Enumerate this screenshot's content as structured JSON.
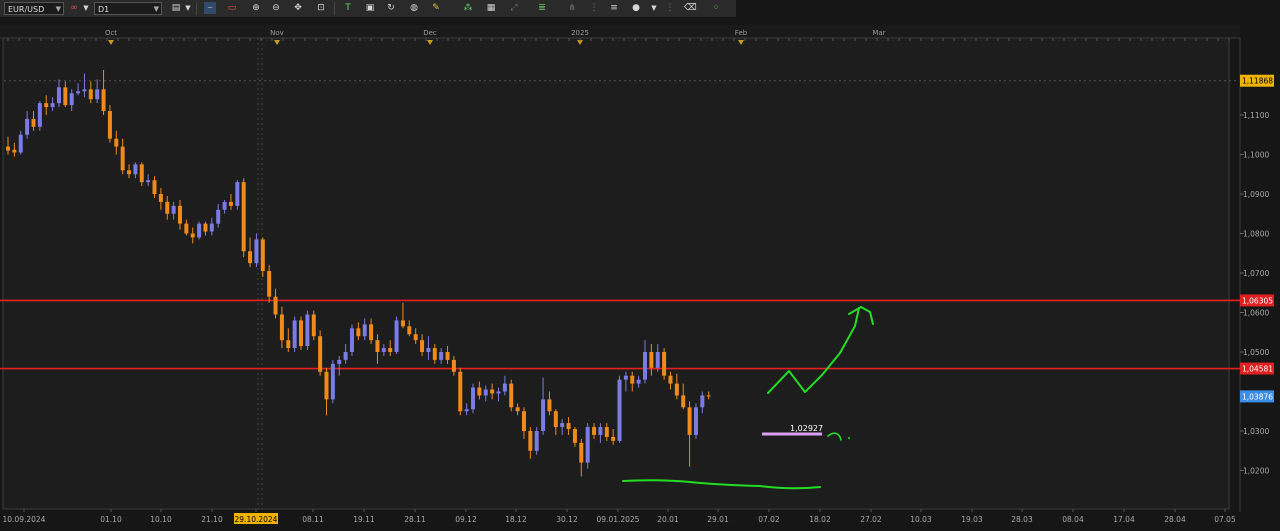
{
  "toolbar": {
    "symbol": "EUR/USD",
    "timeframe": "D1",
    "icons": [
      "chart-type-icon",
      "line-tool-icon",
      "rectangle-tool-icon",
      "zoom-in-icon",
      "zoom-out-icon",
      "crosshair-icon",
      "fit-icon",
      "text-tool-icon",
      "note-icon",
      "refresh-icon",
      "magnet-icon",
      "brush-icon",
      "indicators-icon",
      "template-icon",
      "fibonacci-icon",
      "grid-icon",
      "pitchfork-icon",
      "circle-icon",
      "more-icon",
      "eraser-icon",
      "settings-icon"
    ]
  },
  "top_axis": {
    "labels": [
      "Oct",
      "Nov",
      "Dec",
      "2025",
      "Feb",
      "Mar"
    ]
  },
  "price_axis": {
    "ticks": [
      "1,1100",
      "1,1000",
      "1,0900",
      "1,0800",
      "1,0700",
      "1,0600",
      "1,0500",
      "1,0300",
      "1,0200"
    ],
    "markers": [
      {
        "label": "1,11868",
        "value": 1.11868,
        "bg": "#f0b400",
        "fg": "#000000"
      },
      {
        "label": "1,06305",
        "value": 1.06305,
        "bg": "#e02020",
        "fg": "#ffffff"
      },
      {
        "label": "1,04581",
        "value": 1.04581,
        "bg": "#e02020",
        "fg": "#ffffff"
      },
      {
        "label": "1,03876",
        "value": 1.03876,
        "bg": "#3a8ee6",
        "fg": "#ffffff"
      }
    ]
  },
  "date_axis": {
    "labels": [
      "10.09.2024",
      "01.10",
      "10.10",
      "21.10",
      "29.10.2024",
      "08.11",
      "19.11",
      "28.11",
      "09.12",
      "18.12",
      "30.12",
      "09.01.2025",
      "20.01",
      "29.01",
      "07.02",
      "18.02",
      "27.02",
      "10.03",
      "19.03",
      "28.03",
      "08.04",
      "17.04",
      "28.04",
      "07.05"
    ],
    "highlight_label": "29.10.2024"
  },
  "annotations": {
    "price_label": "1,02927",
    "resistance_upper": 1.06305,
    "resistance_lower": 1.04581
  },
  "colors": {
    "bull": "#7b7be6",
    "bear": "#f08a1a",
    "hline": "#e52020",
    "drawing": "#22dd22",
    "marker_line": "#d8a0f0"
  },
  "chart_data": {
    "type": "candlestick",
    "symbol": "EUR/USD",
    "timeframe": "D1",
    "candles": [
      [
        1.102,
        1.1045,
        1.1,
        1.101
      ],
      [
        1.1012,
        1.103,
        1.0995,
        1.1005
      ],
      [
        1.1005,
        1.106,
        1.1,
        1.105
      ],
      [
        1.105,
        1.111,
        1.104,
        1.109
      ],
      [
        1.109,
        1.111,
        1.106,
        1.107
      ],
      [
        1.107,
        1.1135,
        1.106,
        1.113
      ],
      [
        1.113,
        1.115,
        1.11,
        1.112
      ],
      [
        1.112,
        1.1145,
        1.111,
        1.113
      ],
      [
        1.113,
        1.119,
        1.112,
        1.117
      ],
      [
        1.117,
        1.1185,
        1.112,
        1.1125
      ],
      [
        1.1125,
        1.1165,
        1.111,
        1.1155
      ],
      [
        1.1155,
        1.118,
        1.115,
        1.116
      ],
      [
        1.116,
        1.1205,
        1.1145,
        1.1165
      ],
      [
        1.1165,
        1.1185,
        1.113,
        1.114
      ],
      [
        1.114,
        1.119,
        1.113,
        1.1165
      ],
      [
        1.1165,
        1.1214,
        1.11,
        1.111
      ],
      [
        1.111,
        1.1125,
        1.103,
        1.104
      ],
      [
        1.104,
        1.106,
        1.1,
        1.102
      ],
      [
        1.102,
        1.104,
        1.095,
        1.096
      ],
      [
        1.096,
        1.0975,
        1.094,
        1.095
      ],
      [
        1.095,
        1.098,
        1.094,
        1.0975
      ],
      [
        1.0975,
        1.098,
        1.092,
        1.093
      ],
      [
        1.093,
        1.095,
        1.092,
        1.0935
      ],
      [
        1.0935,
        1.0945,
        1.089,
        1.09
      ],
      [
        1.09,
        1.0915,
        1.086,
        1.088
      ],
      [
        1.088,
        1.0895,
        1.0835,
        1.085
      ],
      [
        1.085,
        1.088,
        1.0835,
        1.087
      ],
      [
        1.087,
        1.0885,
        1.081,
        1.0825
      ],
      [
        1.0825,
        1.0835,
        1.0795,
        1.08
      ],
      [
        1.08,
        1.0815,
        1.0775,
        1.079
      ],
      [
        1.079,
        1.083,
        1.0785,
        1.0825
      ],
      [
        1.0825,
        1.083,
        1.0795,
        1.0805
      ],
      [
        1.0805,
        1.084,
        1.0795,
        1.0825
      ],
      [
        1.0825,
        1.0875,
        1.0815,
        1.086
      ],
      [
        1.086,
        1.0885,
        1.085,
        1.088
      ],
      [
        1.088,
        1.09,
        1.086,
        1.087
      ],
      [
        1.087,
        1.0935,
        1.086,
        1.093
      ],
      [
        1.093,
        1.094,
        1.074,
        1.0755
      ],
      [
        1.0755,
        1.079,
        1.0715,
        1.0725
      ],
      [
        1.0725,
        1.08,
        1.0715,
        1.0785
      ],
      [
        1.0785,
        1.079,
        1.069,
        1.0705
      ],
      [
        1.0705,
        1.072,
        1.0625,
        1.064
      ],
      [
        1.064,
        1.066,
        1.0585,
        1.0595
      ],
      [
        1.0595,
        1.0615,
        1.051,
        1.053
      ],
      [
        1.053,
        1.056,
        1.05,
        1.051
      ],
      [
        1.051,
        1.059,
        1.05,
        1.058
      ],
      [
        1.058,
        1.059,
        1.0505,
        1.0515
      ],
      [
        1.0515,
        1.0605,
        1.0505,
        1.0595
      ],
      [
        1.0595,
        1.0605,
        1.053,
        1.054
      ],
      [
        1.054,
        1.0555,
        1.044,
        1.045
      ],
      [
        1.045,
        1.046,
        1.034,
        1.038
      ],
      [
        1.038,
        1.048,
        1.037,
        1.047
      ],
      [
        1.047,
        1.049,
        1.044,
        1.048
      ],
      [
        1.048,
        1.052,
        1.047,
        1.05
      ],
      [
        1.05,
        1.057,
        1.049,
        1.056
      ],
      [
        1.056,
        1.0575,
        1.053,
        1.054
      ],
      [
        1.054,
        1.0585,
        1.053,
        1.057
      ],
      [
        1.057,
        1.0585,
        1.052,
        1.053
      ],
      [
        1.053,
        1.0545,
        1.047,
        1.05
      ],
      [
        1.05,
        1.052,
        1.049,
        1.051
      ],
      [
        1.051,
        1.053,
        1.049,
        1.05
      ],
      [
        1.05,
        1.059,
        1.0495,
        1.058
      ],
      [
        1.058,
        1.0625,
        1.056,
        1.0565
      ],
      [
        1.0565,
        1.058,
        1.054,
        1.0545
      ],
      [
        1.0545,
        1.056,
        1.052,
        1.053
      ],
      [
        1.053,
        1.0545,
        1.049,
        1.05
      ],
      [
        1.05,
        1.054,
        1.048,
        1.051
      ],
      [
        1.051,
        1.052,
        1.047,
        1.048
      ],
      [
        1.048,
        1.051,
        1.047,
        1.05
      ],
      [
        1.05,
        1.0515,
        1.047,
        1.048
      ],
      [
        1.048,
        1.049,
        1.044,
        1.045
      ],
      [
        1.045,
        1.046,
        1.034,
        1.035
      ],
      [
        1.035,
        1.037,
        1.034,
        1.0355
      ],
      [
        1.0355,
        1.042,
        1.0345,
        1.041
      ],
      [
        1.041,
        1.0425,
        1.038,
        1.039
      ],
      [
        1.039,
        1.0415,
        1.0375,
        1.0405
      ],
      [
        1.0405,
        1.042,
        1.038,
        1.0395
      ],
      [
        1.0395,
        1.041,
        1.0375,
        1.04
      ],
      [
        1.04,
        1.044,
        1.039,
        1.042
      ],
      [
        1.042,
        1.043,
        1.035,
        1.036
      ],
      [
        1.036,
        1.037,
        1.034,
        1.035
      ],
      [
        1.035,
        1.036,
        1.028,
        1.03
      ],
      [
        1.03,
        1.031,
        1.023,
        1.025
      ],
      [
        1.025,
        1.031,
        1.024,
        1.03
      ],
      [
        1.03,
        1.0435,
        1.029,
        1.038
      ],
      [
        1.038,
        1.04,
        1.034,
        1.035
      ],
      [
        1.035,
        1.0355,
        1.029,
        1.031
      ],
      [
        1.031,
        1.033,
        1.029,
        1.032
      ],
      [
        1.032,
        1.0335,
        1.029,
        1.0305
      ],
      [
        1.0305,
        1.031,
        1.026,
        1.027
      ],
      [
        1.027,
        1.028,
        1.0185,
        1.022
      ],
      [
        1.022,
        1.032,
        1.0205,
        1.031
      ],
      [
        1.031,
        1.032,
        1.028,
        1.029
      ],
      [
        1.029,
        1.032,
        1.027,
        1.031
      ],
      [
        1.031,
        1.032,
        1.0275,
        1.0285
      ],
      [
        1.0285,
        1.0305,
        1.0265,
        1.0275
      ],
      [
        1.0275,
        1.044,
        1.027,
        1.043
      ],
      [
        1.043,
        1.045,
        1.04,
        1.044
      ],
      [
        1.044,
        1.045,
        1.04,
        1.042
      ],
      [
        1.042,
        1.044,
        1.041,
        1.043
      ],
      [
        1.043,
        1.053,
        1.042,
        1.05
      ],
      [
        1.05,
        1.052,
        1.044,
        1.046
      ],
      [
        1.046,
        1.052,
        1.045,
        1.05
      ],
      [
        1.05,
        1.051,
        1.043,
        1.044
      ],
      [
        1.044,
        1.045,
        1.0405,
        1.042
      ],
      [
        1.042,
        1.0445,
        1.038,
        1.039
      ],
      [
        1.039,
        1.042,
        1.0355,
        1.036
      ],
      [
        1.036,
        1.0375,
        1.021,
        1.029
      ],
      [
        1.029,
        1.037,
        1.028,
        1.036
      ],
      [
        1.036,
        1.04,
        1.0345,
        1.039
      ],
      [
        1.039,
        1.04,
        1.038,
        1.0388
      ]
    ]
  }
}
